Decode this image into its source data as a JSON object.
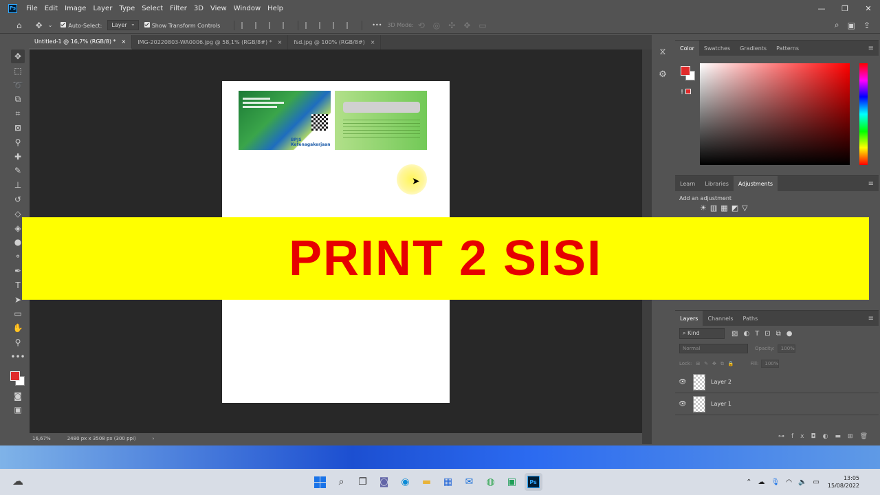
{
  "app": {
    "logo": "Ps"
  },
  "menu": [
    "File",
    "Edit",
    "Image",
    "Layer",
    "Type",
    "Select",
    "Filter",
    "3D",
    "View",
    "Window",
    "Help"
  ],
  "window_controls": {
    "minimize": "—",
    "restore": "❐",
    "close": "✕"
  },
  "options": {
    "auto_select_label": "Auto-Select:",
    "layer_select_value": "Layer",
    "transform_label": "Show Transform Controls",
    "mode_3d_label": "3D Mode:",
    "more": "•••"
  },
  "tabs": [
    {
      "label": "Untitled-1 @ 16,7% (RGB/8) *",
      "active": true
    },
    {
      "label": "IMG-20220803-WA0006.jpg @ 58,1% (RGB/8#) *",
      "active": false
    },
    {
      "label": "fsd.jpg @ 100% (RGB/8#)",
      "active": false
    }
  ],
  "tab_close": "×",
  "status": {
    "zoom": "16,67%",
    "doc_info": "2480 px x 3508 px (300 ppi)",
    "arrow": "›"
  },
  "card": {
    "logo_text": "BPJS Ketenagakerjaan"
  },
  "color_panel": {
    "tabs": [
      "Color",
      "Swatches",
      "Gradients",
      "Patterns"
    ],
    "warning": "!"
  },
  "adjustments_panel": {
    "tabs": [
      "Learn",
      "Libraries",
      "Adjustments"
    ],
    "label": "Add an adjustment"
  },
  "layers_panel": {
    "tabs": [
      "Layers",
      "Channels",
      "Paths"
    ],
    "kind": "Kind",
    "blend_mode": "Normal",
    "opacity_label": "Opacity:",
    "opacity_value": "100%",
    "lock_label": "Lock:",
    "fill_label": "Fill:",
    "fill_value": "100%",
    "layers": [
      "Layer 2",
      "Layer 1"
    ]
  },
  "banner": {
    "text": "PRINT 2 SISI",
    "bg_color": "#ffff00",
    "text_color": "#e60000"
  },
  "taskbar": {
    "time": "13:05",
    "date": "15/08/2022"
  }
}
